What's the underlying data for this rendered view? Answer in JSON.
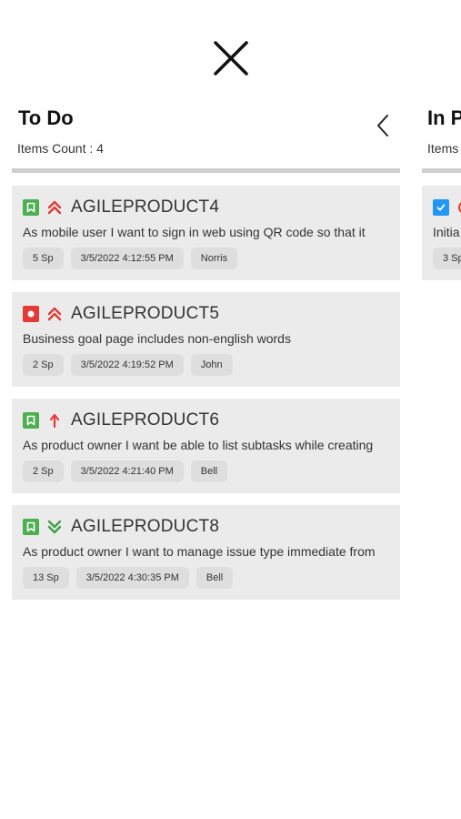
{
  "close_icon": "close-x-icon",
  "columns": [
    {
      "title": "To Do",
      "count_text": "Items Count : 4",
      "cards": [
        {
          "key": "AGILEPRODUCT4",
          "summary": "As mobile user I want to sign in web using QR code so that it",
          "type": "story",
          "type_color": "#4caf50",
          "priority": "highest",
          "tags": [
            "5 Sp",
            "3/5/2022 4:12:55 PM",
            "Norris"
          ]
        },
        {
          "key": "AGILEPRODUCT5",
          "summary": "Business goal page includes non-english words",
          "type": "bug",
          "type_color": "#e53935",
          "priority": "highest",
          "tags": [
            "2 Sp",
            "3/5/2022 4:19:52 PM",
            "John"
          ]
        },
        {
          "key": "AGILEPRODUCT6",
          "summary": "As product owner I want be able to list subtasks while creating",
          "type": "story",
          "type_color": "#4caf50",
          "priority": "high",
          "tags": [
            "2 Sp",
            "3/5/2022 4:21:40 PM",
            "Bell"
          ]
        },
        {
          "key": "AGILEPRODUCT8",
          "summary": "As product owner I want to manage issue type immediate from",
          "type": "story",
          "type_color": "#4caf50",
          "priority": "lowest",
          "tags": [
            "13 Sp",
            "3/5/2022 4:30:35 PM",
            "Bell"
          ]
        }
      ]
    },
    {
      "title": "In P",
      "count_text": "Items",
      "cards": [
        {
          "summary": "Initia",
          "type": "task",
          "type_color": "#2196f3",
          "tags": [
            "3 Sp"
          ]
        }
      ]
    }
  ],
  "colors": {
    "card_bg": "#ebebeb",
    "tag_bg": "#dedede",
    "divider": "#cfcfcf",
    "priority_high": "#e53935",
    "priority_low": "#43a047"
  }
}
